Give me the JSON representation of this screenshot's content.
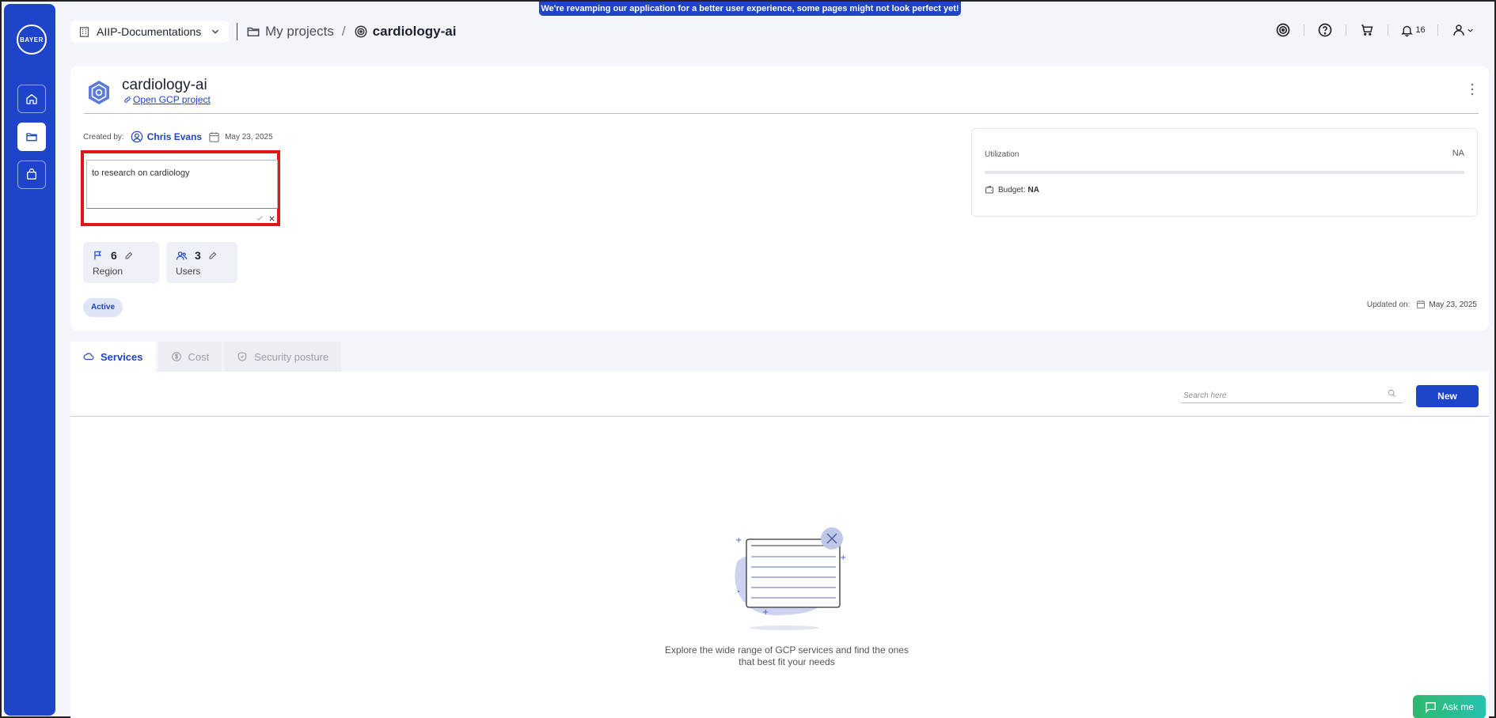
{
  "banner": "We're revamping our application for a better user experience, some pages might not look perfect yet!",
  "sidebar": {
    "logo_text": "BAYER"
  },
  "header": {
    "workspace": "AIIP-Documentations",
    "breadcrumb": {
      "parent": "My projects",
      "separator": "/",
      "current": "cardiology-ai"
    },
    "notification_count": "16"
  },
  "project": {
    "title": "cardiology-ai",
    "link_label": "Open GCP project",
    "created_by_label": "Created by:",
    "creator": "Chris Evans",
    "created_date": "May 23, 2025",
    "description": "to research on cardiology",
    "region": {
      "value": "6",
      "label": "Region"
    },
    "users": {
      "value": "3",
      "label": "Users"
    },
    "status": "Active",
    "updated_label": "Updated on:",
    "updated_date": "May 23, 2025",
    "utilization": {
      "label": "Utilization",
      "value": "NA",
      "fraction": 0
    },
    "budget": {
      "label": "Budget:",
      "value": "NA"
    }
  },
  "tabs": [
    {
      "label": "Services",
      "active": true
    },
    {
      "label": "Cost",
      "active": false
    },
    {
      "label": "Security posture",
      "active": false
    }
  ],
  "services": {
    "search_placeholder": "Search here",
    "new_label": "New",
    "empty_line1": "Explore the wide range of GCP services and find the ones",
    "empty_line2": "that best fit your needs"
  },
  "chat": {
    "label": "Ask me"
  },
  "colors": {
    "brand": "#1d44c9",
    "highlight": "#e0161b",
    "chat": "#2fb86b"
  }
}
